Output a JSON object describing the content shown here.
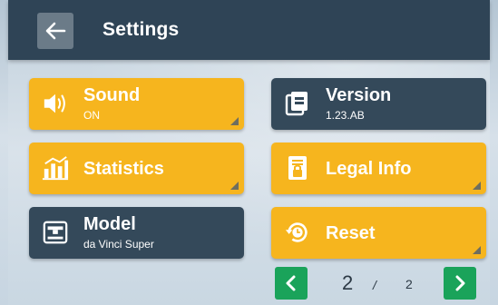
{
  "header": {
    "title": "Settings",
    "back_icon": "arrow-left-icon"
  },
  "tiles": {
    "sound": {
      "label": "Sound",
      "sub": "ON",
      "icon": "speaker-icon",
      "color": "#f6b51e"
    },
    "version": {
      "label": "Version",
      "sub": "1.23.AB",
      "icon": "document-stack-icon",
      "color": "#34495a"
    },
    "statistics": {
      "label": "Statistics",
      "icon": "bar-chart-icon",
      "color": "#f6b51e"
    },
    "legal": {
      "label": "Legal Info",
      "icon": "lock-document-icon",
      "color": "#f6b51e"
    },
    "model": {
      "label": "Model",
      "sub": "da Vinci Super",
      "icon": "printer-icon",
      "color": "#34495a"
    },
    "reset": {
      "label": "Reset",
      "icon": "reset-clock-icon",
      "color": "#f6b51e"
    }
  },
  "pager": {
    "current": "2",
    "separator": "/",
    "total": "2",
    "prev_icon": "chevron-left-icon",
    "next_icon": "chevron-right-icon",
    "color": "#1aa35a"
  }
}
